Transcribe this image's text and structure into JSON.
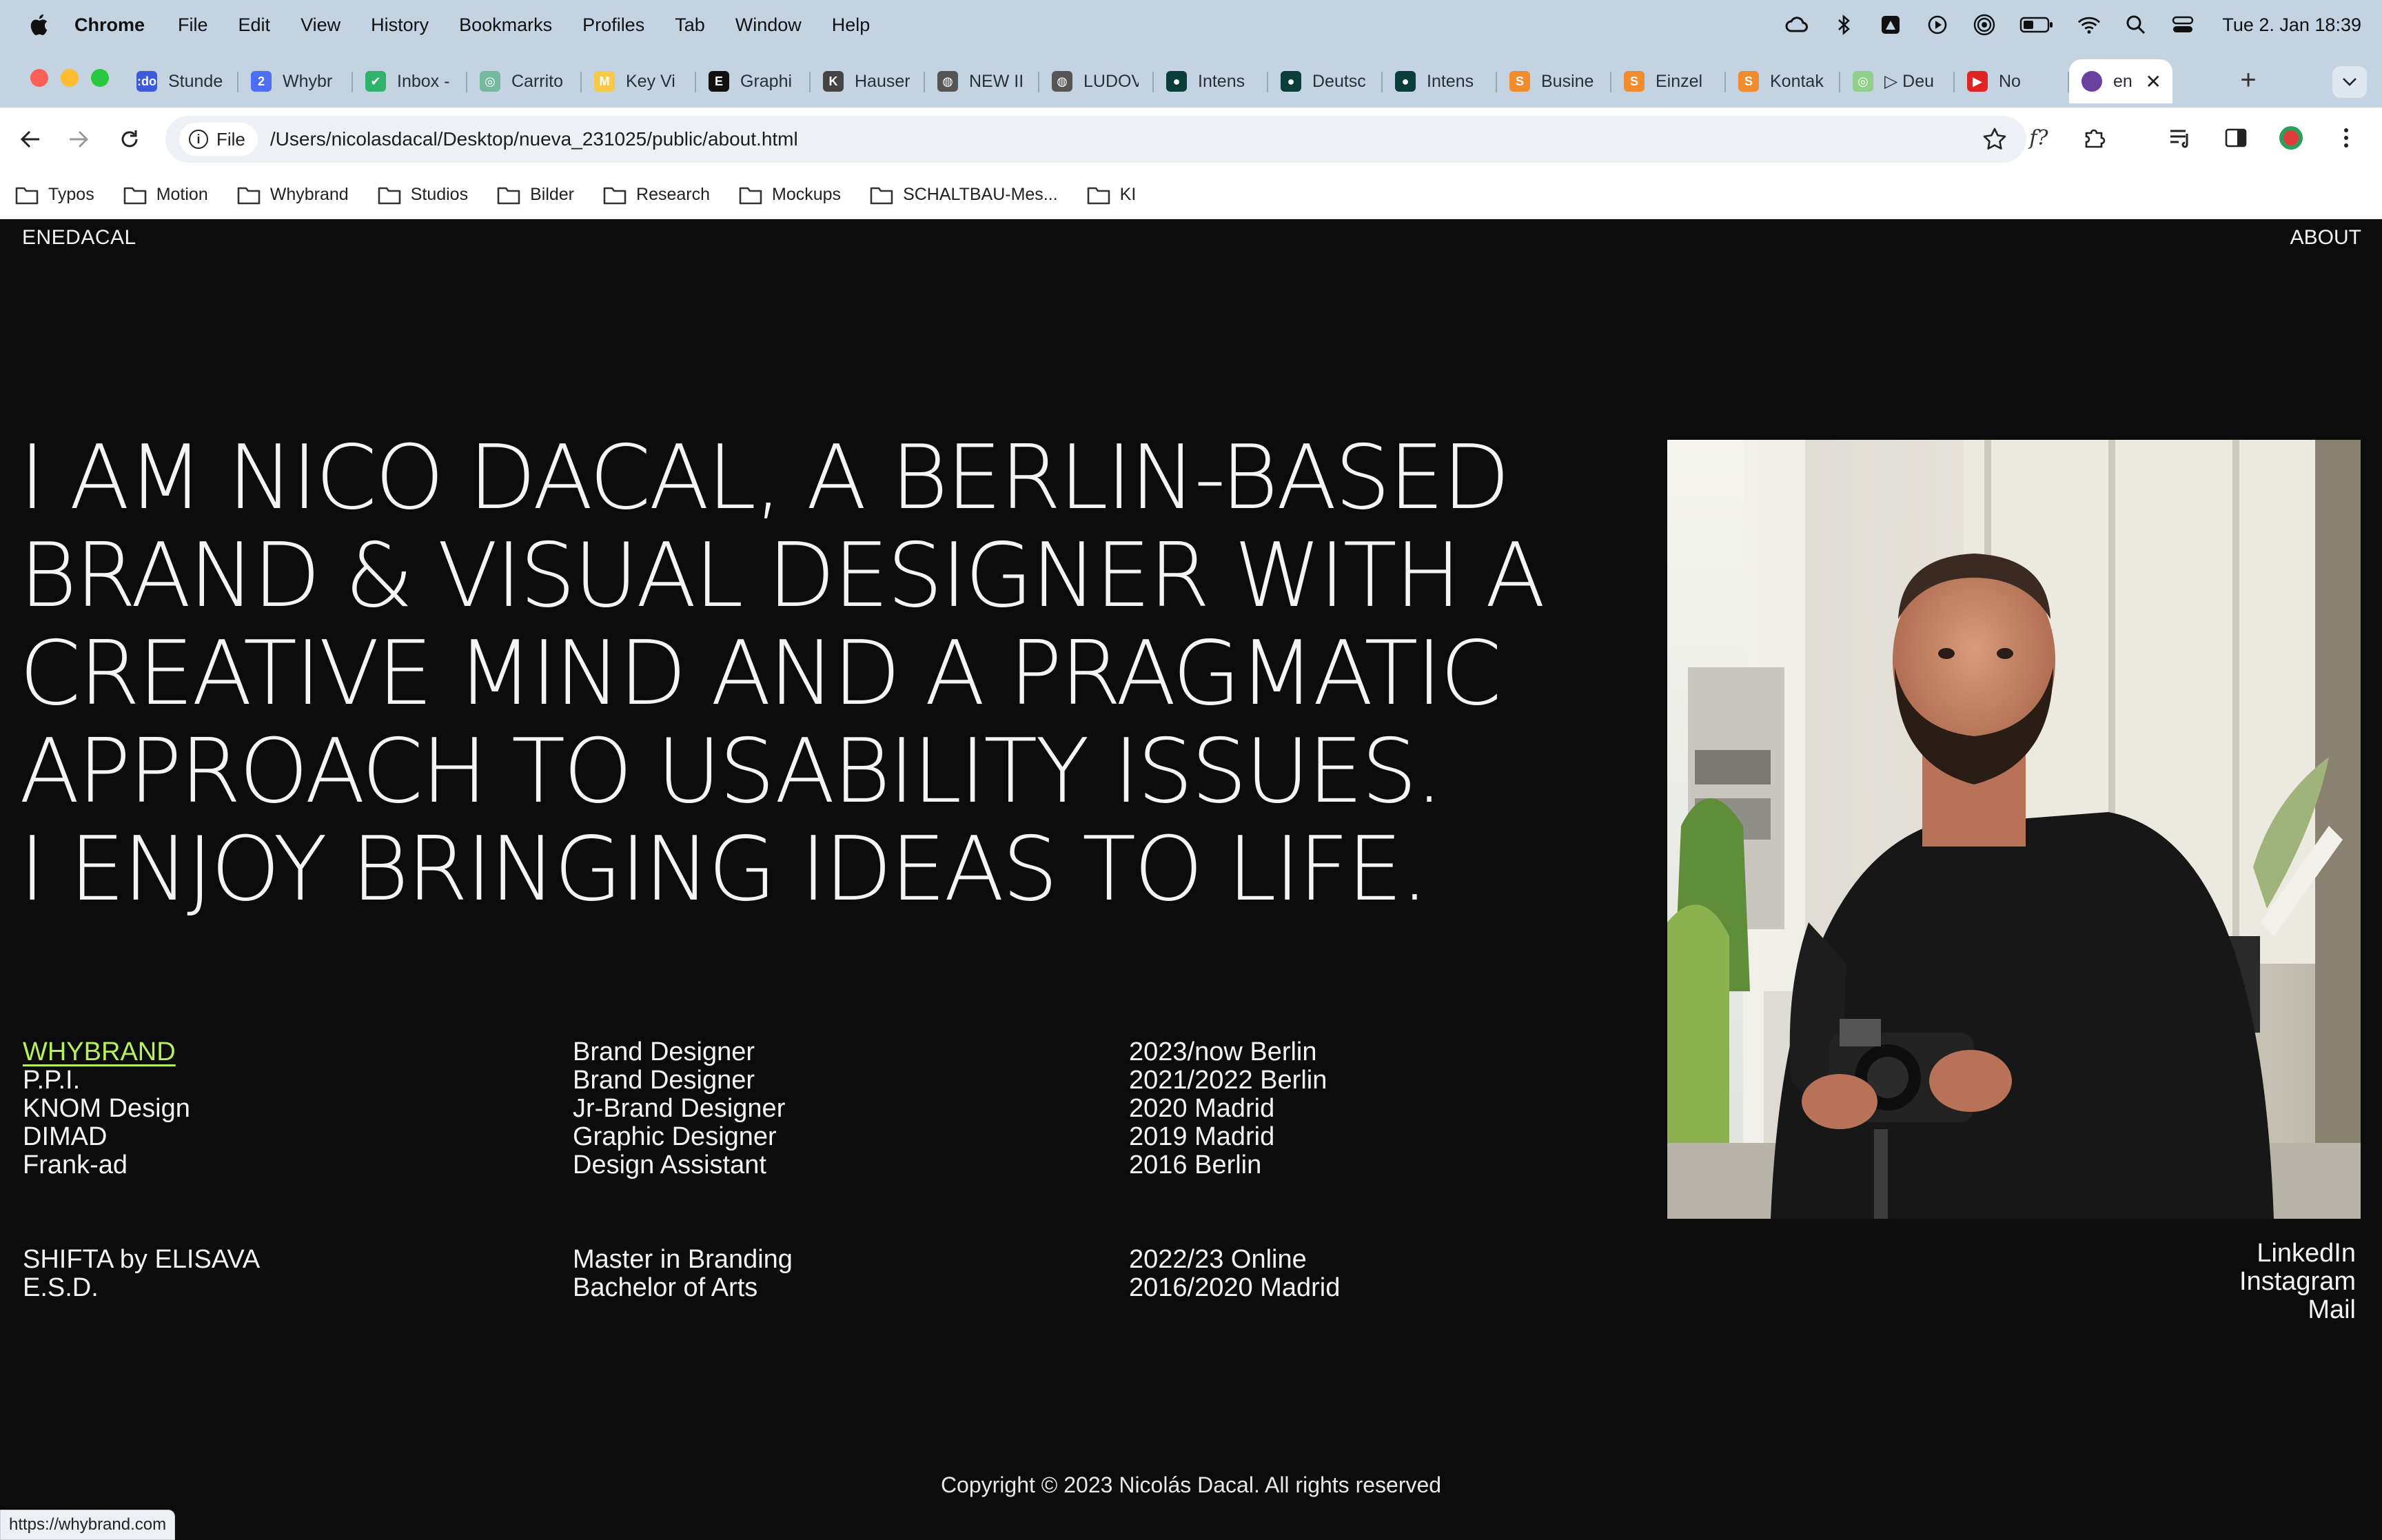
{
  "menubar": {
    "app": "Chrome",
    "items": [
      "File",
      "Edit",
      "View",
      "History",
      "Bookmarks",
      "Profiles",
      "Tab",
      "Window",
      "Help"
    ],
    "clock": "Tue 2. Jan  18:39"
  },
  "tabs": [
    {
      "label": "Stunde",
      "color": "#3b5bdb",
      "glyph": ":do"
    },
    {
      "label": "Whybr",
      "color": "#4c6ef5",
      "glyph": "2"
    },
    {
      "label": "Inbox -",
      "color": "#2fb36b",
      "glyph": "✔"
    },
    {
      "label": "Carrito",
      "color": "#74b9a0",
      "glyph": "◎"
    },
    {
      "label": "Key Vi",
      "color": "#f7c948",
      "glyph": "M"
    },
    {
      "label": "Graphi",
      "color": "#111111",
      "glyph": "E"
    },
    {
      "label": "Hauser",
      "color": "#444444",
      "glyph": "K"
    },
    {
      "label": "NEW II",
      "color": "#555555",
      "glyph": "◍"
    },
    {
      "label": "LUDOV",
      "color": "#555555",
      "glyph": "◍"
    },
    {
      "label": "Intens",
      "color": "#0b3d3a",
      "glyph": "●"
    },
    {
      "label": "Deutsc",
      "color": "#0b3d3a",
      "glyph": "●"
    },
    {
      "label": "Intens",
      "color": "#0b3d3a",
      "glyph": "●"
    },
    {
      "label": "Busine",
      "color": "#f08c2e",
      "glyph": "S"
    },
    {
      "label": "Einzel",
      "color": "#f08c2e",
      "glyph": "S"
    },
    {
      "label": "Kontak",
      "color": "#f08c2e",
      "glyph": "S"
    },
    {
      "label": "▷ Deu",
      "color": "#8fcf8a",
      "glyph": "◎"
    },
    {
      "label": "No",
      "color": "#e02424",
      "glyph": "▶"
    }
  ],
  "active_tab": {
    "label": "en"
  },
  "toolbar": {
    "chip": "File",
    "url": "/Users/nicolasdacal/Desktop/nueva_231025/public/about.html"
  },
  "bookmarks": [
    "Typos",
    "Motion",
    "Whybrand",
    "Studios",
    "Bilder",
    "Research",
    "Mockups",
    "SCHALTBAU-Mes...",
    "KI"
  ],
  "site": {
    "brand": "ENEDACAL",
    "about": "ABOUT",
    "headline": [
      "I AM NICO DACAL, A BERLIN-BASED",
      "BRAND & VISUAL DESIGNER WITH A",
      "CREATIVE MIND AND A PRAGMATIC",
      "APPROACH TO USABILITY ISSUES.",
      "I ENJOY BRINGING IDEAS TO LIFE."
    ],
    "experience": {
      "companies": [
        "WHYBRAND",
        "P.P.I.",
        "KNOM Design",
        "DIMAD",
        "Frank-ad"
      ],
      "roles": [
        "Brand Designer",
        "Brand Designer",
        "Jr-Brand Designer",
        "Graphic Designer",
        "Design Assistant"
      ],
      "dates": [
        "2023/now Berlin",
        "2021/2022 Berlin",
        "2020 Madrid",
        "2019 Madrid",
        "2016 Berlin"
      ]
    },
    "education": {
      "schools": [
        "SHIFTA by ELISAVA",
        "E.S.D."
      ],
      "degrees": [
        "Master in Branding",
        "Bachelor of Arts"
      ],
      "dates": [
        "2022/23 Online",
        "2016/2020 Madrid"
      ]
    },
    "social": [
      "LinkedIn",
      "Instagram",
      "Mail"
    ],
    "copyright": "Copyright © 2023 Nicolás Dacal. All rights reserved",
    "accent": "#b8f05a"
  },
  "status_url": "https://whybrand.com"
}
